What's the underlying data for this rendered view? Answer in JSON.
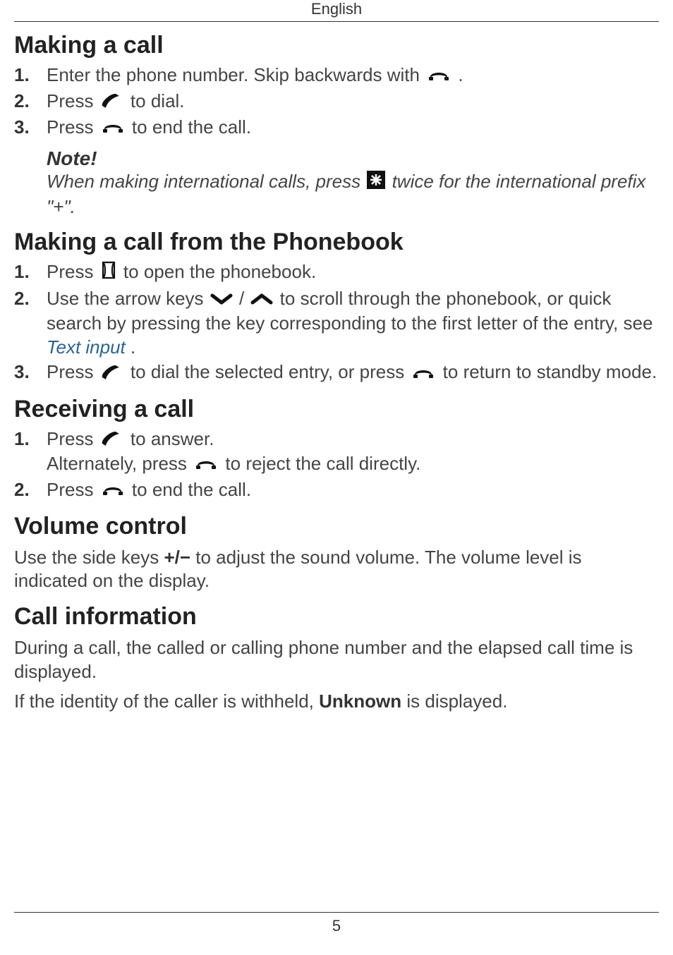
{
  "header": {
    "language": "English"
  },
  "sections": {
    "making_call": {
      "title": "Making a call",
      "steps": {
        "s1_a": "Enter the phone number. Skip backwards with ",
        "s1_b": ".",
        "s2_a": "Press ",
        "s2_b": " to dial.",
        "s3_a": "Press ",
        "s3_b": " to end the call."
      },
      "note": {
        "heading": "Note!",
        "a": "When making international calls, press ",
        "b": " twice for the international prefix \"+\"."
      }
    },
    "phonebook": {
      "title": "Making a call from the Phonebook",
      "steps": {
        "s1_a": "Press ",
        "s1_b": " to open the phonebook.",
        "s2_a": "Use the arrow keys ",
        "s2_slash": " / ",
        "s2_b": " to scroll through the phone­book, or quick search by pressing the key corresponding to the first letter of the entry, see ",
        "s2_link": "Text input",
        "s2_c": ".",
        "s3_a": "Press ",
        "s3_b": " to dial the selected entry, or press ",
        "s3_c": " to return to standby mode."
      }
    },
    "receiving": {
      "title": "Receiving a call",
      "steps": {
        "s1_a": "Press ",
        "s1_b": " to answer.",
        "s1_c": "Alternately, press ",
        "s1_d": " to reject the call directly.",
        "s2_a": "Press ",
        "s2_b": " to end the call."
      }
    },
    "volume": {
      "title": "Volume control",
      "a": "Use the side keys ",
      "keys": "+/−",
      "b": " to adjust the sound volume. The volume level is indicated on the display."
    },
    "callinfo": {
      "title": "Call information",
      "p1": "During a call, the called or calling phone number and the elapsed call time is displayed.",
      "p2_a": "If the identity of the caller is withheld, ",
      "p2_bold": "Unknown",
      "p2_b": " is displayed."
    }
  },
  "footer": {
    "page": "5"
  }
}
